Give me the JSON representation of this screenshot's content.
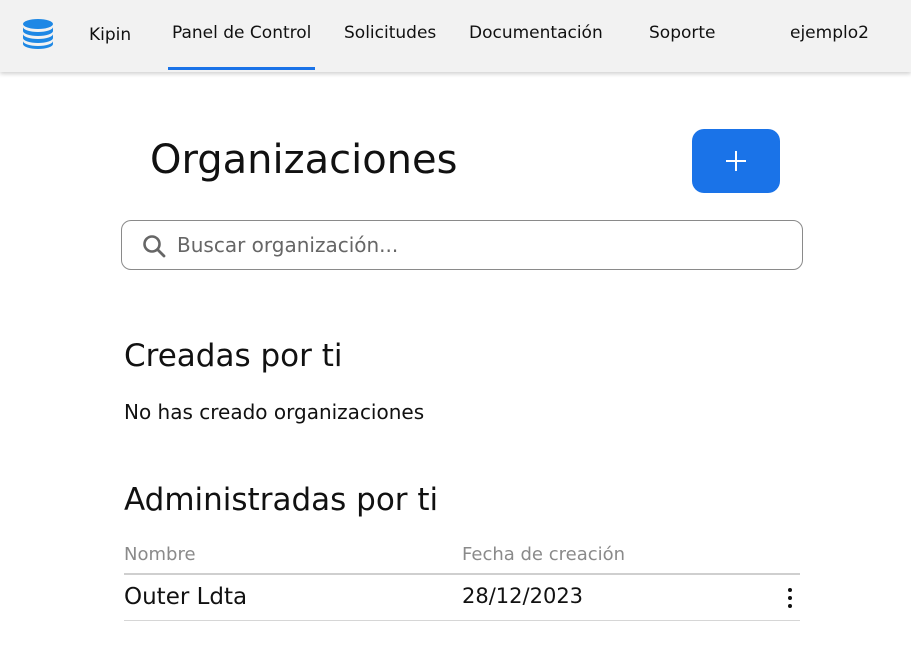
{
  "nav": {
    "logo_icon": "database-stack-icon",
    "brand": "Kipin",
    "items": [
      "Panel de Control",
      "Solicitudes",
      "Documentación",
      "Soporte"
    ],
    "active_index": 0,
    "user": "ejemplo2"
  },
  "main": {
    "title": "Organizaciones",
    "add_button_icon": "plus-icon",
    "search": {
      "placeholder": "Buscar organización...",
      "value": ""
    },
    "created": {
      "title": "Creadas por ti",
      "empty_text": "No has creado organizaciones"
    },
    "administered": {
      "title": "Administradas por ti",
      "columns": [
        "Nombre",
        "Fecha de creación"
      ],
      "rows": [
        {
          "name": "Outer Ldta",
          "date": "28/12/2023"
        }
      ]
    }
  },
  "colors": {
    "accent": "#1a73e8",
    "navbar_bg": "#f2f2f2"
  }
}
